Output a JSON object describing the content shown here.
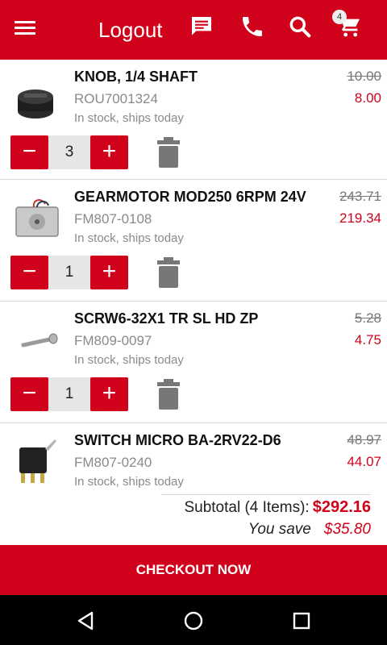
{
  "header": {
    "title": "Logout",
    "cart_count": "4",
    "icons": [
      "menu-icon",
      "chat-icon",
      "phone-icon",
      "search-icon",
      "cart-icon"
    ]
  },
  "cart": {
    "items": [
      {
        "name": "KNOB, 1/4 SHAFT",
        "sku": "ROU7001324",
        "stock": "In stock, ships today",
        "old_price": "10.00",
        "price": "8.00",
        "qty": "3",
        "image": "knob-image"
      },
      {
        "name": "GEARMOTOR MOD250 6RPM 24V",
        "sku": "FM807-0108",
        "stock": "In stock, ships today",
        "old_price": "243.71",
        "price": "219.34",
        "qty": "1",
        "image": "gearmotor-image"
      },
      {
        "name": "SCRW6-32X1 TR SL HD ZP",
        "sku": "FM809-0097",
        "stock": "In stock, ships today",
        "old_price": "5.28",
        "price": "4.75",
        "qty": "1",
        "image": "screw-image"
      },
      {
        "name": "SWITCH MICRO BA-2RV22-D6",
        "sku": "FM807-0240",
        "stock": "In stock, ships today",
        "old_price": "48.97",
        "price": "44.07",
        "image": "switch-image"
      }
    ],
    "minus_label": "−",
    "plus_label": "+"
  },
  "totals": {
    "subtotal_label": "Subtotal (4 Items):",
    "subtotal_value": "$292.16",
    "save_label": "You save",
    "save_value": "$35.80"
  },
  "checkout_label": "CHECKOUT NOW",
  "system_nav": [
    "back-icon",
    "home-icon",
    "recents-icon"
  ],
  "colors": {
    "accent": "#d0021b",
    "muted_text": "#8a8a8a",
    "navbar": "#000000"
  }
}
